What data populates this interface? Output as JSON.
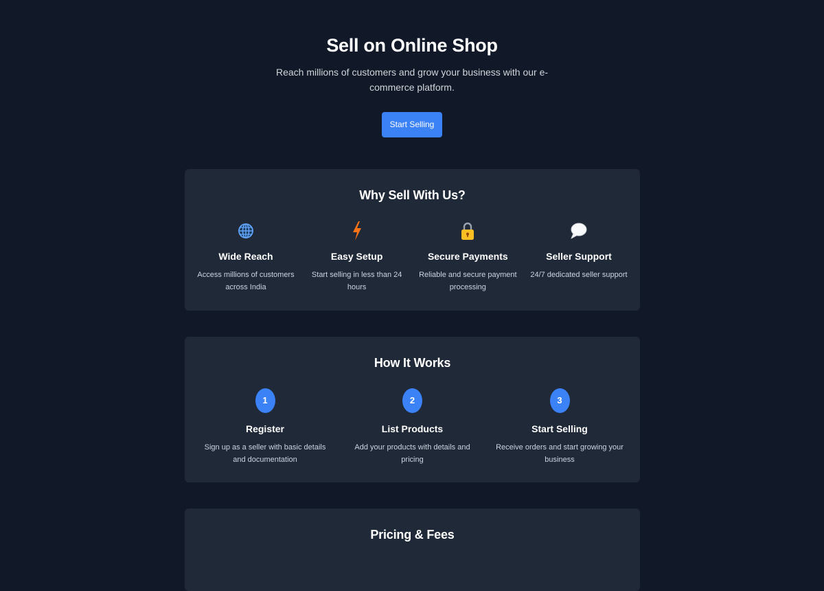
{
  "hero": {
    "title": "Sell on Online Shop",
    "subtitle": "Reach millions of customers and grow your business with our e-commerce platform.",
    "cta_label": "Start Selling"
  },
  "why": {
    "title": "Why Sell With Us?",
    "features": [
      {
        "icon": "globe-icon",
        "title": "Wide Reach",
        "desc": "Access millions of customers across India"
      },
      {
        "icon": "lightning-icon",
        "title": "Easy Setup",
        "desc": "Start selling in less than 24 hours"
      },
      {
        "icon": "lock-icon",
        "title": "Secure Payments",
        "desc": "Reliable and secure payment processing"
      },
      {
        "icon": "speech-bubble-icon",
        "title": "Seller Support",
        "desc": "24/7 dedicated seller support"
      }
    ]
  },
  "how": {
    "title": "How It Works",
    "steps": [
      {
        "number": "1",
        "title": "Register",
        "desc": "Sign up as a seller with basic details and documentation"
      },
      {
        "number": "2",
        "title": "List Products",
        "desc": "Add your products with details and pricing"
      },
      {
        "number": "3",
        "title": "Start Selling",
        "desc": "Receive orders and start growing your business"
      }
    ]
  },
  "pricing": {
    "title": "Pricing & Fees"
  },
  "colors": {
    "background": "#111827",
    "card": "#1f2937",
    "accent": "#3b82f6"
  }
}
